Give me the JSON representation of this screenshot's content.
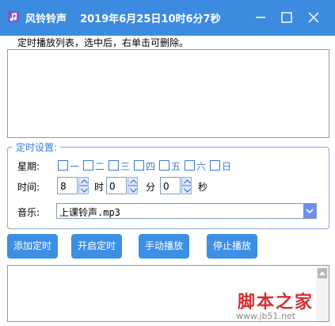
{
  "window": {
    "app_name": "风铃铃声",
    "datetime": "2019年6月25日10时6分7秒",
    "icon": "music-note-icon"
  },
  "hint": "定时播放列表，选中后，右单击可删除。",
  "settings": {
    "legend": "定时设置:",
    "weekday_label": "星期:",
    "weekdays": [
      "一",
      "二",
      "三",
      "四",
      "五",
      "六",
      "日"
    ],
    "time_label": "时间:",
    "hour_value": "8",
    "hour_unit": "时",
    "minute_value": "0",
    "minute_unit": "分",
    "second_value": "0",
    "second_unit": "秒",
    "music_label": "音乐:",
    "music_value": "上课铃声.mp3"
  },
  "buttons": {
    "add": "添加定时",
    "start": "开启定时",
    "manual": "手动播放",
    "stop": "停止播放"
  },
  "watermark": {
    "text": "脚本之家",
    "url": "www.jb51.net"
  },
  "colors": {
    "titlebar": "#3c8be0",
    "button": "#3d8fe3",
    "accent": "#3a7bd5",
    "watermark": "#d32f2f"
  }
}
